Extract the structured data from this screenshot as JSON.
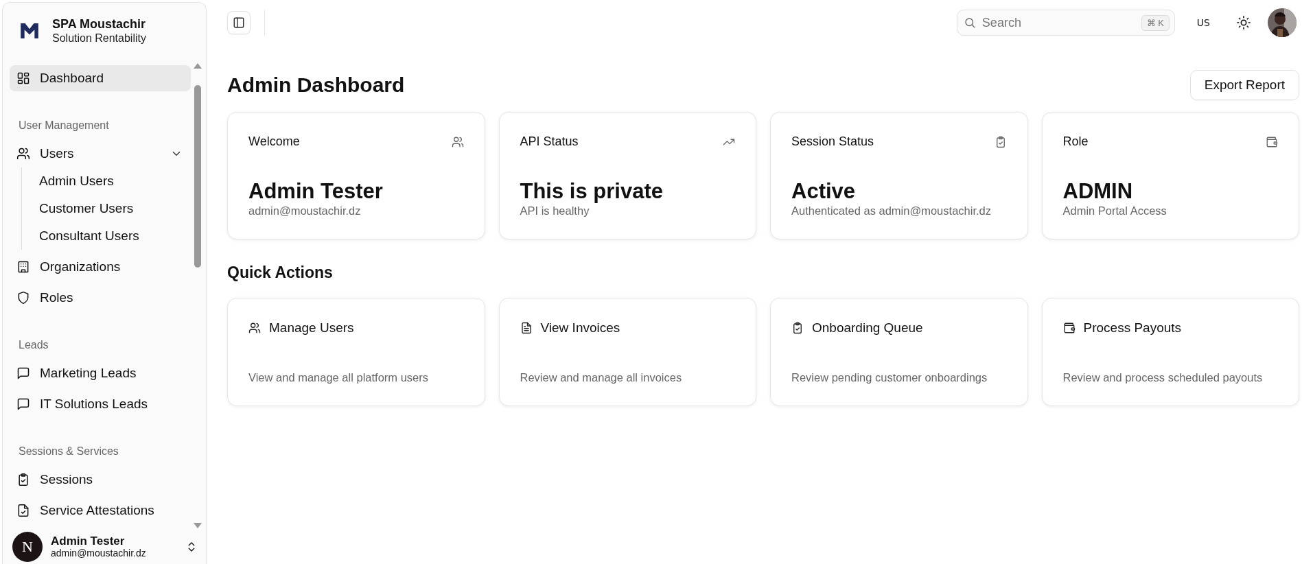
{
  "sidebar": {
    "brand": {
      "title": "SPA Moustachir",
      "subtitle": "Solution Rentability"
    },
    "items": [
      {
        "label": "Dashboard",
        "selected": true
      }
    ],
    "sections": [
      {
        "heading": "User Management",
        "items": [
          {
            "label": "Users",
            "selected": false,
            "expanded": true,
            "children": [
              {
                "label": "Admin Users",
                "selected": false
              },
              {
                "label": "Customer Users",
                "selected": false
              },
              {
                "label": "Consultant Users",
                "selected": false
              }
            ]
          },
          {
            "label": "Organizations",
            "selected": false
          },
          {
            "label": "Roles",
            "selected": false
          }
        ]
      },
      {
        "heading": "Leads",
        "items": [
          {
            "label": "Marketing Leads",
            "selected": false
          },
          {
            "label": "IT Solutions Leads",
            "selected": false
          }
        ]
      },
      {
        "heading": "Sessions & Services",
        "items": [
          {
            "label": "Sessions",
            "selected": false
          },
          {
            "label": "Service Attestations",
            "selected": false
          }
        ]
      }
    ],
    "user": {
      "initial": "N",
      "name": "Admin Tester",
      "email": "admin@moustachir.dz"
    }
  },
  "topbar": {
    "search": {
      "placeholder": "Search",
      "shortcut": "⌘ K"
    },
    "locale": "US"
  },
  "page": {
    "title": "Admin Dashboard",
    "action": "Export Report"
  },
  "stats": [
    {
      "title": "Welcome",
      "value": "Admin Tester",
      "detail": "admin@moustachir.dz"
    },
    {
      "title": "API Status",
      "value": "This is private",
      "detail": "API is healthy"
    },
    {
      "title": "Session Status",
      "value": "Active",
      "detail": "Authenticated as admin@moustachir.dz"
    },
    {
      "title": "Role",
      "value": "ADMIN",
      "detail": "Admin Portal Access"
    }
  ],
  "quick_actions": {
    "heading": "Quick Actions",
    "items": [
      {
        "title": "Manage Users",
        "description": "View and manage all platform users"
      },
      {
        "title": "View Invoices",
        "description": "Review and manage all invoices"
      },
      {
        "title": "Onboarding Queue",
        "description": "Review pending customer onboardings"
      },
      {
        "title": "Process Payouts",
        "description": "Review and process scheduled payouts"
      }
    ]
  }
}
